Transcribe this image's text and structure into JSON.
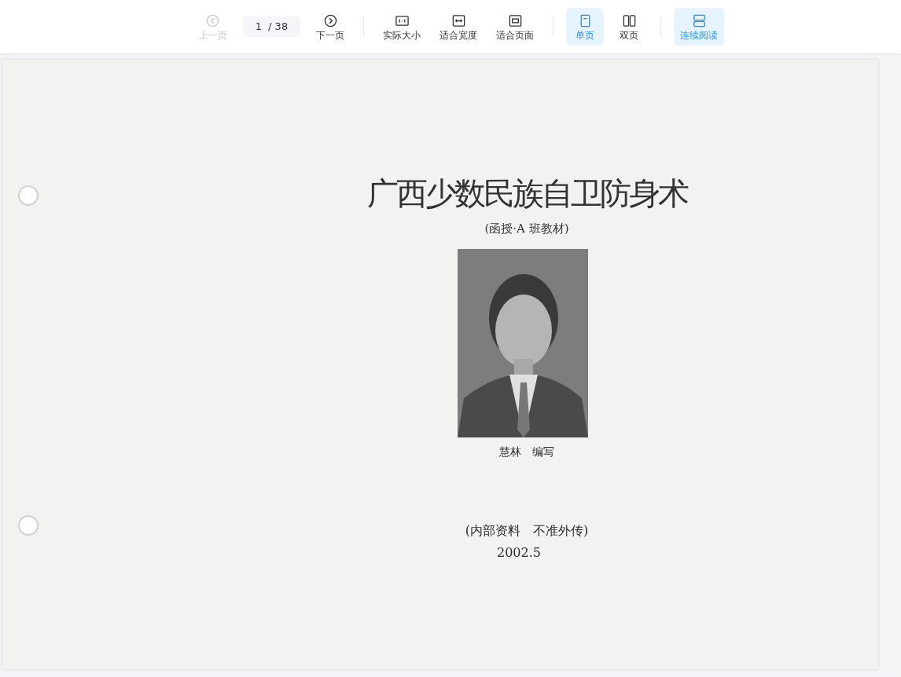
{
  "toolbar": {
    "nav": [
      {
        "kind": "prev",
        "label": "上一页",
        "disabled": true
      },
      {
        "kind": "next",
        "label": "下一页",
        "disabled": false
      }
    ],
    "page_field": {
      "value": "1",
      "total": "/ 38"
    },
    "zoom_buttons": [
      {
        "kind": "actual",
        "label": "实际大小"
      },
      {
        "kind": "width",
        "label": "适合宽度"
      },
      {
        "kind": "page",
        "label": "适合页面"
      }
    ],
    "page_modes": [
      {
        "kind": "single",
        "label": "单页",
        "selected": true
      },
      {
        "kind": "double",
        "label": "双页",
        "selected": false
      }
    ],
    "continuous": {
      "label": "连续阅读",
      "on": true
    }
  },
  "document": {
    "title": "广西少数民族自卫防身术",
    "subtitle": "(函授·A 班教材)",
    "author": "慧林　编写",
    "notice": "(内部资料　不准外传)",
    "date": "2002.5"
  }
}
